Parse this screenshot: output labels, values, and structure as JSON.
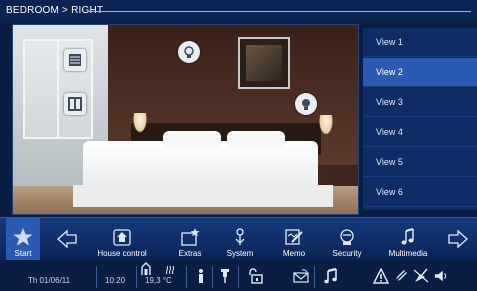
{
  "header": {
    "title": "BEDROOM > RIGHT"
  },
  "views": [
    {
      "label": "View 1",
      "selected": false
    },
    {
      "label": "View 2",
      "selected": true
    },
    {
      "label": "View 3",
      "selected": false
    },
    {
      "label": "View 4",
      "selected": false
    },
    {
      "label": "View 5",
      "selected": false
    },
    {
      "label": "View 6",
      "selected": false
    }
  ],
  "photo": {
    "hotspots": [
      "shutter-control-icon",
      "shutter-control-icon",
      "light-bulb-icon",
      "light-bulb-icon"
    ]
  },
  "nav": {
    "start_label": "Start",
    "items": [
      {
        "label": "House control",
        "icon": "house-icon"
      },
      {
        "label": "Extras",
        "icon": "extras-star-icon"
      },
      {
        "label": "System",
        "icon": "system-icon"
      },
      {
        "label": "Memo",
        "icon": "memo-icon"
      },
      {
        "label": "Security",
        "icon": "security-icon"
      },
      {
        "label": "Multimedia",
        "icon": "music-note-icon"
      }
    ]
  },
  "status": {
    "date": "Th 01/06/11",
    "time": "10:20",
    "temperature": "19,3 °C"
  },
  "colors": {
    "background": "#0a1e44",
    "panel": "#0f2c66",
    "selected": "#2a5ab2",
    "text": "#ffffff"
  }
}
